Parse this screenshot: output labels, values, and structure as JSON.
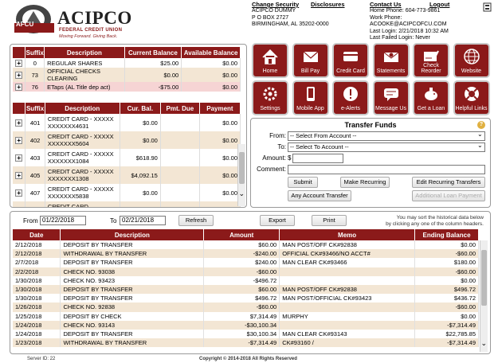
{
  "brand": {
    "name": "ACIPCO",
    "badge": "AFCU",
    "subtitle": "FEDERAL CREDIT UNION",
    "tagline": "Moving Forward. Giving Back.",
    "color_primary": "#8b1a1a"
  },
  "header_links": {
    "change_security": "Change Security",
    "disclosures": "Disclosures",
    "contact_us": "Contact Us",
    "logout": "Logout"
  },
  "member": {
    "name": "ACIPCO DUMMY",
    "address1": "P O BOX 2727",
    "address2": "BIRMINGHAM, AL 35202-0000"
  },
  "contact": {
    "home_phone": "Home Phone: 604-773-9861",
    "work_phone": "Work Phone:",
    "email": "ACOOKE@ACIPCOFCU.COM",
    "last_login": "Last Login: 2/21/2018 10:32 AM",
    "last_failed": "Last Failed Login: Never"
  },
  "shares": {
    "headers": [
      "Suffix",
      "Description",
      "Current Balance",
      "Available Balance"
    ],
    "rows": [
      {
        "suffix": "0",
        "description": "REGULAR SHARES",
        "current": "$25.00",
        "available": "$0.00",
        "style": "odd"
      },
      {
        "suffix": "73",
        "description": "OFFICIAL CHECKS CLEARING",
        "current": "$0.00",
        "available": "$0.00",
        "style": "even"
      },
      {
        "suffix": "76",
        "description": "ETaps (AL Title dep act)",
        "current": "-$75.00",
        "available": "$0.00",
        "style": "neg"
      }
    ]
  },
  "loans": {
    "headers": [
      "Suffix",
      "Description",
      "Cur. Bal.",
      "Pmt. Due",
      "Payment"
    ],
    "rows": [
      {
        "suffix": "401",
        "description": "CREDIT CARD - XXXXXXXXXXXX4631",
        "balance": "$0.00",
        "due": "",
        "payment": "$0.00"
      },
      {
        "suffix": "402",
        "description": "CREDIT CARD - XXXXXXXXXXXX5604",
        "balance": "$0.00",
        "due": "",
        "payment": "$0.00"
      },
      {
        "suffix": "403",
        "description": "CREDIT CARD - XXXXXXXXXXXX1084",
        "balance": "$618.90",
        "due": "",
        "payment": "$0.00"
      },
      {
        "suffix": "405",
        "description": "CREDIT CARD - XXXXXXXXXXXX1308",
        "balance": "$4,092.15",
        "due": "",
        "payment": "$0.00"
      },
      {
        "suffix": "407",
        "description": "CREDIT CARD - XXXXXXXXXXXX5838",
        "balance": "$0.00",
        "due": "",
        "payment": "$0.00"
      },
      {
        "suffix": "",
        "description": "CREDIT CARD",
        "balance": "",
        "due": "",
        "payment": ""
      }
    ]
  },
  "tiles": [
    {
      "label": "Home",
      "icon": "house-icon"
    },
    {
      "label": "Bill Pay",
      "icon": "envelope-icon"
    },
    {
      "label": "Credit Card",
      "icon": "credit-card-icon"
    },
    {
      "label": "Statements",
      "icon": "statement-envelope-icon"
    },
    {
      "label": "Check Reorder",
      "icon": "check-icon"
    },
    {
      "label": "Website",
      "icon": "globe-icon"
    },
    {
      "label": "Settings",
      "icon": "gears-icon"
    },
    {
      "label": "Mobile App",
      "icon": "phone-icon"
    },
    {
      "label": "e-Alerts",
      "icon": "alert-icon"
    },
    {
      "label": "Message Us",
      "icon": "message-icon"
    },
    {
      "label": "Get a Loan",
      "icon": "piggy-bank-icon"
    },
    {
      "label": "Helpful Links",
      "icon": "lifebuoy-icon"
    }
  ],
  "transfer": {
    "title": "Transfer Funds",
    "from_label": "From:",
    "to_label": "To:",
    "amount_label": "Amount:",
    "currency": "$",
    "comment_label": "Comment:",
    "from_value": "-- Select From Account --",
    "to_value": "-- Select To Account --",
    "submit": "Submit",
    "make_recurring": "Make Recurring",
    "edit_recurring": "Edit Recurring Transfers",
    "any_account": "Any Account Transfer",
    "additional_loan": "Additional Loan Payment"
  },
  "history": {
    "from_label": "From",
    "from_date": "01/22/2018",
    "to_label": "To",
    "to_date": "02/21/2018",
    "refresh": "Refresh",
    "export": "Export",
    "print": "Print",
    "sort_hint1": "You may sort the historical data below",
    "sort_hint2": "by clicking any one of the column headers.",
    "headers": [
      "Date",
      "Description",
      "Amount",
      "Memo",
      "Ending Balance"
    ],
    "rows": [
      {
        "date": "2/12/2018",
        "description": "DEPOSIT BY TRANSFER",
        "amount": "$60.00",
        "memo": "MAN POST/OFF CK#92838",
        "balance": "$0.00"
      },
      {
        "date": "2/12/2018",
        "description": "WITHDRAWAL BY TRANSFER",
        "amount": "-$240.00",
        "memo": "OFFICIAL CK#93466/NO ACCT#",
        "balance": "-$60.00"
      },
      {
        "date": "2/7/2018",
        "description": "DEPOSIT BY TRANSFER",
        "amount": "$240.00",
        "memo": "MAN CLEAR CK#93466",
        "balance": "$180.00"
      },
      {
        "date": "2/2/2018",
        "description": "CHECK NO. 93038",
        "amount": "-$60.00",
        "memo": "",
        "balance": "-$60.00"
      },
      {
        "date": "1/30/2018",
        "description": "CHECK NO. 93423",
        "amount": "-$496.72",
        "memo": "",
        "balance": "$0.00"
      },
      {
        "date": "1/30/2018",
        "description": "DEPOSIT BY TRANSFER",
        "amount": "$60.00",
        "memo": "MAN POST/OFF CK#92838",
        "balance": "$496.72"
      },
      {
        "date": "1/30/2018",
        "description": "DEPOSIT BY TRANSFER",
        "amount": "$496.72",
        "memo": "MAN POST/OFFICIAL CK#93423",
        "balance": "$436.72"
      },
      {
        "date": "1/26/2018",
        "description": "CHECK NO. 92838",
        "amount": "-$60.00",
        "memo": "",
        "balance": "-$60.00"
      },
      {
        "date": "1/25/2018",
        "description": "DEPOSIT BY CHECK",
        "amount": "$7,314.49",
        "memo": "MURPHY",
        "balance": "$0.00"
      },
      {
        "date": "1/24/2018",
        "description": "CHECK NO. 93143",
        "amount": "-$30,100.34",
        "memo": "",
        "balance": "-$7,314.49"
      },
      {
        "date": "1/24/2018",
        "description": "DEPOSIT BY TRANSFER",
        "amount": "$30,100.34",
        "memo": "MAN CLEAR CK#93143",
        "balance": "$22,785.85"
      },
      {
        "date": "1/23/2018",
        "description": "WITHDRAWAL BY TRANSFER",
        "amount": "-$7,314.49",
        "memo": "CK#93160 /",
        "balance": "-$7,314.49"
      }
    ]
  },
  "footer": {
    "server": "Server ID: 22",
    "copyright": "Copyright © 2014-2018 All Rights Reserved"
  }
}
